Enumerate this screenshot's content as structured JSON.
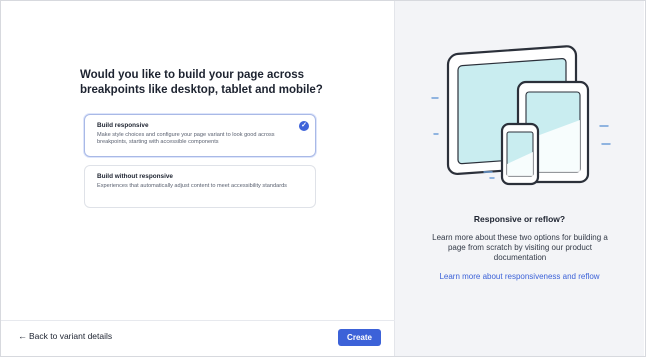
{
  "question": {
    "line1": "Would you like to build your page across",
    "line2": "breakpoints like desktop, tablet and mobile?"
  },
  "options": [
    {
      "title": "Build responsive",
      "description": "Make style choices and configure your page variant to look good across breakpoints, starting with accessible components",
      "selected": true
    },
    {
      "title": "Build without responsive",
      "description": "Experiences that automatically adjust content to meet accessibility standards",
      "selected": false
    }
  ],
  "footer": {
    "back_label": "Back to variant details",
    "create_label": "Create"
  },
  "info": {
    "title": "Responsive or reflow?",
    "body": "Learn more about these two options for building a page from scratch by visiting our product documentation",
    "link": "Learn more about responsiveness and reflow"
  },
  "colors": {
    "accent": "#3c62d8",
    "screen": "#c9edf0",
    "panel_bg": "#f3f4f7"
  },
  "icons": {
    "check": "check-circle-icon",
    "back": "arrow-left-icon",
    "illustration": "devices-illustration"
  }
}
